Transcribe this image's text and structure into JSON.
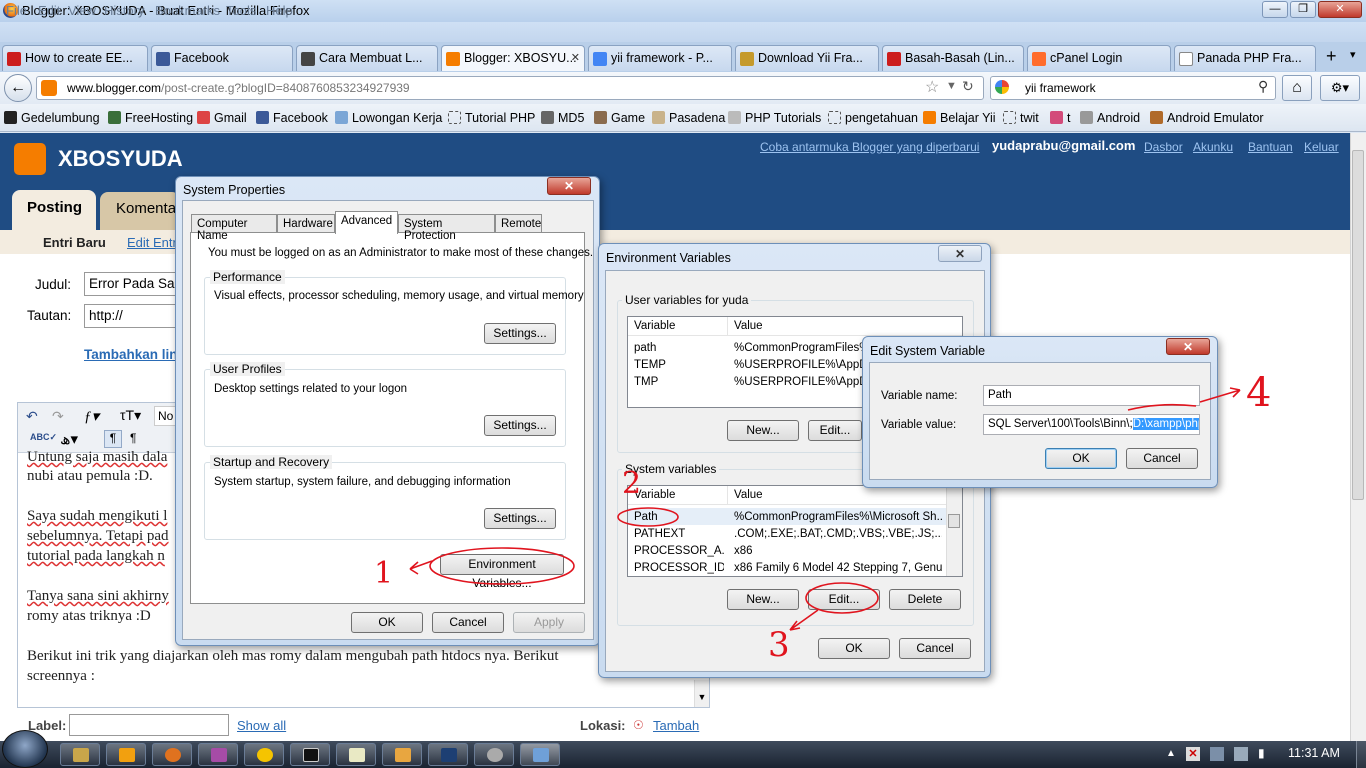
{
  "window": {
    "title": "Blogger: XBOSYUDA - Buat Entri - Mozilla Firefox"
  },
  "menu": [
    "File",
    "Edit",
    "View",
    "History",
    "Bookmarks",
    "Tools",
    "Help"
  ],
  "tabs": [
    {
      "label": "How to create EE...",
      "color": "#cc1d1d"
    },
    {
      "label": "Facebook",
      "color": "#3b5998"
    },
    {
      "label": "Cara Membuat L...",
      "color": "#444444"
    },
    {
      "label": "Blogger: XBOSYU...",
      "color": "#f57d00"
    },
    {
      "label": "yii framework - P...",
      "color": "#4285f4"
    },
    {
      "label": "Download Yii Fra...",
      "color": "#c59a2c"
    },
    {
      "label": "Basah-Basah (Lin...",
      "color": "#cc1d1d"
    },
    {
      "label": "cPanel Login",
      "color": "#ff6c2c"
    },
    {
      "label": "Panada PHP Fra...",
      "color": "#ffffff"
    }
  ],
  "address": {
    "host": "www.blogger.com",
    "path": "/post-create.g?blogID=8408760853234927939"
  },
  "search": {
    "value": "yii framework"
  },
  "bookmarks": [
    "Gedelumbung",
    "FreeHosting",
    "Gmail",
    "Facebook",
    "Lowongan Kerja",
    "Tutorial PHP",
    "MD5",
    "Game",
    "Pasadena",
    "PHP Tutorials",
    "pengetahuan",
    "Belajar Yii",
    "twit",
    "t",
    "Android",
    "Android Emulator"
  ],
  "blogger": {
    "blog_name": "XBOSYUDA",
    "header_links": {
      "new_ui": "Coba antarmuka Blogger yang diperbarui",
      "email": "yudaprabu@gmail.com",
      "dashboard": "Dasbor",
      "account": "Akunku",
      "help": "Bantuan",
      "logout": "Keluar"
    },
    "tab_posting": "Posting",
    "tab_komentar": "Komentar",
    "subtab_new": "Entri Baru",
    "subtab_edit": "Edit Entri",
    "judul_label": "Judul:",
    "judul_value": "Error Pada Saa",
    "tautan_label": "Tautan:",
    "tautan_value": "http://",
    "add_link": "Tambahkan lin",
    "editor_font": "No",
    "body_lines": [
      "Untung saja masih dala",
      "nubi atau pemula :D.",
      "Saya sudah mengikuti l",
      "sebelumnya. Tetapi pad",
      "tutorial pada langkah n",
      "Tanya sana sini akhirny",
      "romy atas triknya :D",
      "Berikut ini trik yang diajarkan oleh mas romy dalam mengubah path htdocs nya. Berikut",
      "screennya :"
    ],
    "label_label": "Label:",
    "show_all": "Show all",
    "lokasi_label": "Lokasi:",
    "lokasi_link": "Tambah"
  },
  "sysprops": {
    "title": "System Properties",
    "tabs": [
      "Computer Name",
      "Hardware",
      "Advanced",
      "System Protection",
      "Remote"
    ],
    "admin_note": "You must be logged on as an Administrator to make most of these changes.",
    "perf_label": "Performance",
    "perf_desc": "Visual effects, processor scheduling, memory usage, and virtual memory",
    "profiles_label": "User Profiles",
    "profiles_desc": "Desktop settings related to your logon",
    "startup_label": "Startup and Recovery",
    "startup_desc": "System startup, system failure, and debugging information",
    "settings_btn": "Settings...",
    "env_btn": "Environment Variables...",
    "ok": "OK",
    "cancel": "Cancel",
    "apply": "Apply"
  },
  "envvars": {
    "title": "Environment Variables",
    "user_label": "User variables for yuda",
    "col_variable": "Variable",
    "col_value": "Value",
    "user_rows": [
      {
        "var": "path",
        "val": "%CommonProgramFiles%\\"
      },
      {
        "var": "TEMP",
        "val": "%USERPROFILE%\\AppDat"
      },
      {
        "var": "TMP",
        "val": "%USERPROFILE%\\AppDat"
      }
    ],
    "new_btn": "New...",
    "edit_btn": "Edit...",
    "delete_btn": "Delete",
    "sys_label": "System variables",
    "sys_rows": [
      {
        "var": "Path",
        "val": "%CommonProgramFiles%\\Microsoft Sh..."
      },
      {
        "var": "PATHEXT",
        "val": ".COM;.EXE;.BAT;.CMD;.VBS;.VBE;.JS;...."
      },
      {
        "var": "PROCESSOR_A...",
        "val": "x86"
      },
      {
        "var": "PROCESSOR_ID...",
        "val": "x86 Family 6 Model 42 Stepping 7, Genu..."
      }
    ],
    "ok": "OK",
    "cancel": "Cancel"
  },
  "editvar": {
    "title": "Edit System Variable",
    "name_label": "Variable name:",
    "name_value": "Path",
    "value_label": "Variable value:",
    "value_prefix": "SQL Server\\100\\Tools\\Binn\\;",
    "value_selected": "D:\\xampp\\php",
    "ok": "OK",
    "cancel": "Cancel"
  },
  "annotations": [
    "1",
    "2",
    "3",
    "4"
  ],
  "taskbar": {
    "clock": "11:31 AM"
  }
}
